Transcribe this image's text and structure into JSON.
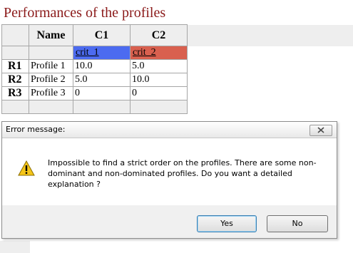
{
  "page": {
    "title": "Performances of the profiles"
  },
  "table": {
    "columns": [
      "Name",
      "C1",
      "C2"
    ],
    "criteria": [
      {
        "label": "crit_1",
        "color": "#4c6bf0"
      },
      {
        "label": "crit_2",
        "color": "#d9604f"
      }
    ],
    "rows": [
      {
        "id": "R1",
        "name": "Profile 1",
        "values": [
          "10.0",
          "5.0"
        ]
      },
      {
        "id": "R2",
        "name": "Profile 2",
        "values": [
          "5.0",
          "10.0"
        ]
      },
      {
        "id": "R3",
        "name": "Profile 3",
        "values": [
          "0",
          "0"
        ]
      }
    ]
  },
  "dialog": {
    "title": "Error message:",
    "icon": "warning-icon",
    "message": "Impossible to find a strict order on the profiles. There are some non-dominant and non-dominated profiles. Do you want a detailed explanation ?",
    "yes_label": "Yes",
    "no_label": "No"
  }
}
